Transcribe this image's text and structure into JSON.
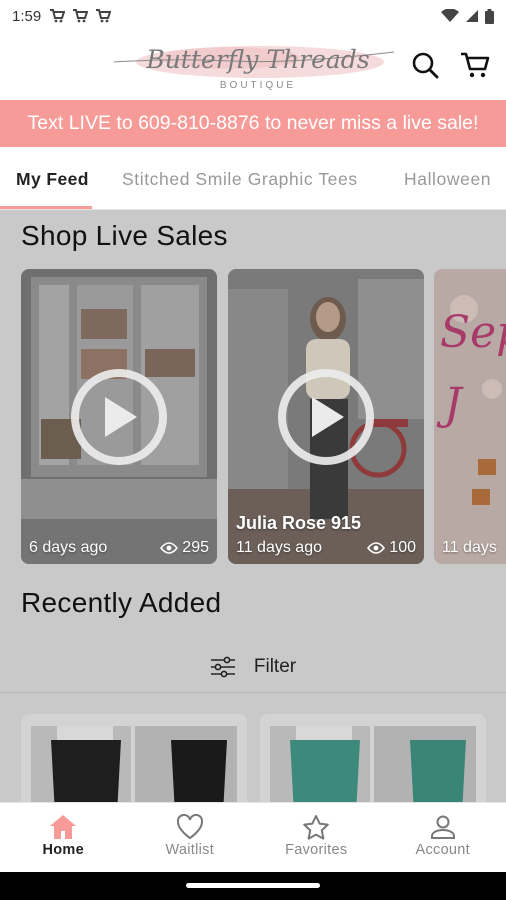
{
  "status_bar": {
    "time": "1:59",
    "notification_icons": [
      "cart-icon",
      "cart-icon",
      "cart-icon"
    ],
    "right_icons": [
      "wifi-icon",
      "signal-icon",
      "battery-icon"
    ]
  },
  "header": {
    "logo_text": "Butterfly Threads",
    "logo_subtext": "BOUTIQUE",
    "icons": [
      "search-icon",
      "cart-icon"
    ]
  },
  "promo_banner": {
    "text": "Text LIVE to 609-810-8876 to never miss a live sale!",
    "color": "#f79b99"
  },
  "tabs": [
    {
      "label": "My Feed",
      "active": true
    },
    {
      "label": "Stitched Smile Graphic Tees",
      "active": false
    },
    {
      "label": "Halloween",
      "active": false
    }
  ],
  "live_sales": {
    "title": "Shop Live Sales",
    "cards": [
      {
        "host": "",
        "age": "6 days ago",
        "views": "295"
      },
      {
        "host": "Julia Rose 915",
        "age": "11 days ago",
        "views": "100"
      },
      {
        "host": "",
        "age": "11 days",
        "views": ""
      }
    ],
    "partial_card_text": "Sep"
  },
  "recently_added": {
    "title": "Recently Added",
    "filter_label": "Filter"
  },
  "bottom_nav": [
    {
      "label": "Home",
      "icon": "home-icon",
      "active": true
    },
    {
      "label": "Waitlist",
      "icon": "heart-icon",
      "active": false
    },
    {
      "label": "Favorites",
      "icon": "star-icon",
      "active": false
    },
    {
      "label": "Account",
      "icon": "person-icon",
      "active": false
    }
  ],
  "colors": {
    "accent": "#f79b99",
    "overlay": "#c9c9c9"
  }
}
